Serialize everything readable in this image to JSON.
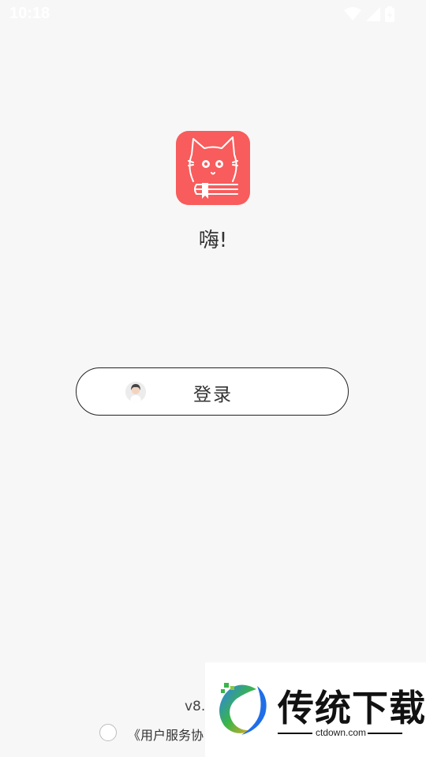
{
  "status_bar": {
    "time": "10:18",
    "icons": [
      "wifi-icon",
      "signal-icon",
      "battery-icon"
    ]
  },
  "app": {
    "logo": "cat-book-logo",
    "logo_color": "#f85c5c",
    "greeting": "嗨!"
  },
  "login": {
    "label": "登录",
    "icon": "avatar-icon"
  },
  "footer": {
    "version": "v8.",
    "agreement_text": "《用户服务协"
  },
  "watermark": {
    "title": "传统下载",
    "subtitle": "ctdown.com"
  }
}
